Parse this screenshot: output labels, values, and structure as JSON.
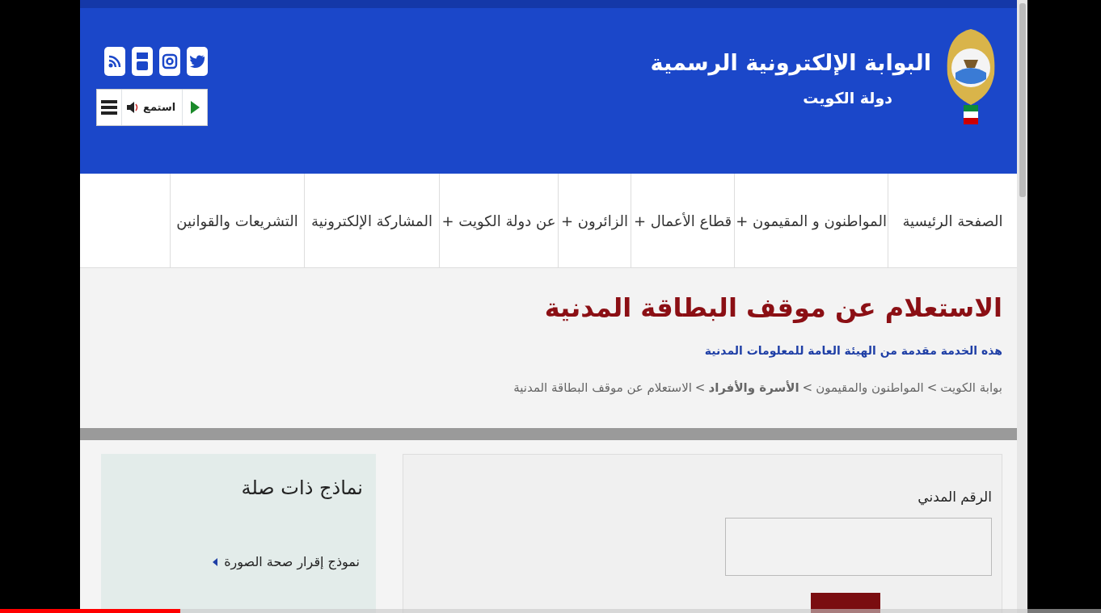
{
  "header": {
    "site_title": "البوابة الإلكترونية الرسمية",
    "site_subtitle": "دولة  الكويت",
    "listen_label": "استمع"
  },
  "nav": [
    {
      "label": "الصفحة الرئيسية"
    },
    {
      "label": "المواطنون و المقيمون +"
    },
    {
      "label": "قطاع الأعمال +"
    },
    {
      "label": "الزائرون +"
    },
    {
      "label": "عن دولة الكويت +"
    },
    {
      "label": "المشاركة الإلكترونية"
    },
    {
      "label": "التشريعات والقوانين"
    }
  ],
  "page": {
    "title": "الاستعلام عن موقف البطاقة المدنية",
    "provider": "هذه الخدمة مقدمة من الهيئة العامة للمعلومات المدنية",
    "breadcrumb_separator": ">",
    "breadcrumb": [
      {
        "label": "بوابة الكويت",
        "bold": false
      },
      {
        "label": "المواطنون والمقيمون",
        "bold": false
      },
      {
        "label": "الأسرة والأفراد",
        "bold": true
      },
      {
        "label": "الاستعلام عن موقف البطاقة المدنية",
        "bold": false
      }
    ]
  },
  "form": {
    "field_label": "الرقم المدني"
  },
  "sidebar": {
    "title": "نماذج ذات صلة",
    "items": [
      {
        "label": "نموذج إقرار صحة الصورة"
      }
    ]
  },
  "video_progress": {
    "level": 0.164
  }
}
